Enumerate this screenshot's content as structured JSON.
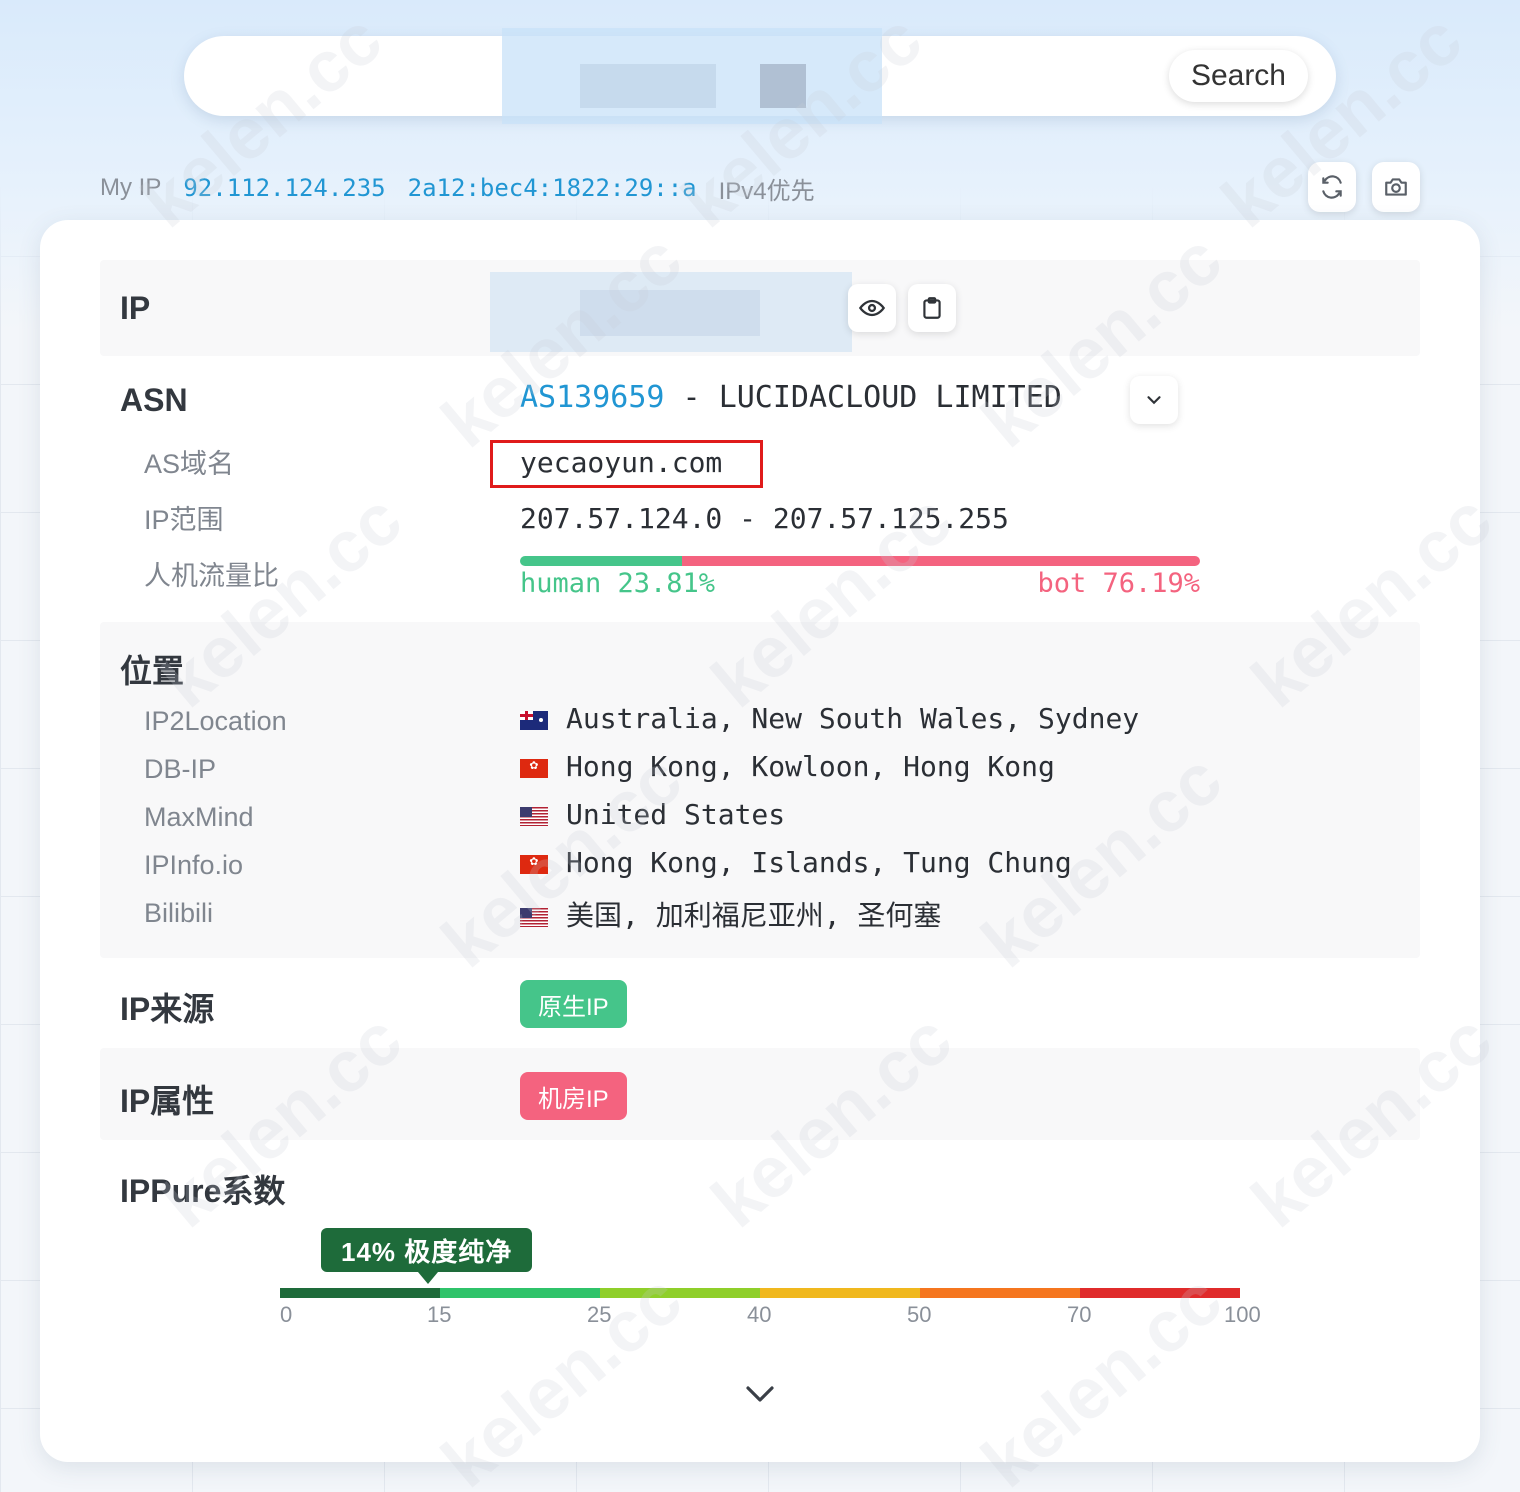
{
  "search": {
    "input_value": "",
    "button_label": "Search"
  },
  "myip": {
    "label": "My IP",
    "ipv4": "92.112.124.235",
    "ipv6": "2a12:bec4:1822:29::a",
    "preference": "IPv4优先"
  },
  "toolbar": {
    "refresh_icon": "refresh-icon",
    "screenshot_icon": "camera-icon"
  },
  "ip_section": {
    "title": "IP",
    "value": "",
    "view_icon": "eye-icon",
    "copy_icon": "clipboard-icon"
  },
  "asn": {
    "title": "ASN",
    "number": "AS139659",
    "separator": " - ",
    "org": "LUCIDACLOUD LIMITED",
    "domain_label": "AS域名",
    "domain": "yecaoyun.com",
    "range_label": "IP范围",
    "range": "207.57.124.0 - 207.57.125.255",
    "traffic_label": "人机流量比",
    "human_label": "human 23.81%",
    "bot_label": "bot 76.19%",
    "human_ratio": 0.2381,
    "bot_ratio": 0.7619,
    "colors": {
      "human": "#45c58a",
      "bot": "#f4637f",
      "link": "#2196d3"
    }
  },
  "location": {
    "title": "位置",
    "rows": [
      {
        "source": "IP2Location",
        "flag": "au",
        "place": "Australia, New South Wales, Sydney"
      },
      {
        "source": "DB-IP",
        "flag": "hk",
        "place": "Hong Kong, Kowloon, Hong Kong"
      },
      {
        "source": "MaxMind",
        "flag": "us",
        "place": "United States"
      },
      {
        "source": "IPInfo.io",
        "flag": "hk",
        "place": "Hong Kong, Islands, Tung Chung"
      },
      {
        "source": "Bilibili",
        "flag": "us",
        "place": "美国, 加利福尼亚州, 圣何塞"
      }
    ]
  },
  "source": {
    "title": "IP来源",
    "tag": "原生IP"
  },
  "attribute": {
    "title": "IP属性",
    "tag": "机房IP"
  },
  "pure": {
    "title": "IPPure系数",
    "badge": "14% 极度纯净",
    "score_percent": 14,
    "ticks": [
      "0",
      "15",
      "25",
      "40",
      "50",
      "70",
      "100"
    ],
    "segment_colors": [
      "#1e6b3a",
      "#2fc36a",
      "#8fcf2a",
      "#f0b81e",
      "#f5761f",
      "#e02b2b"
    ]
  },
  "watermark_text": "kelen.cc"
}
